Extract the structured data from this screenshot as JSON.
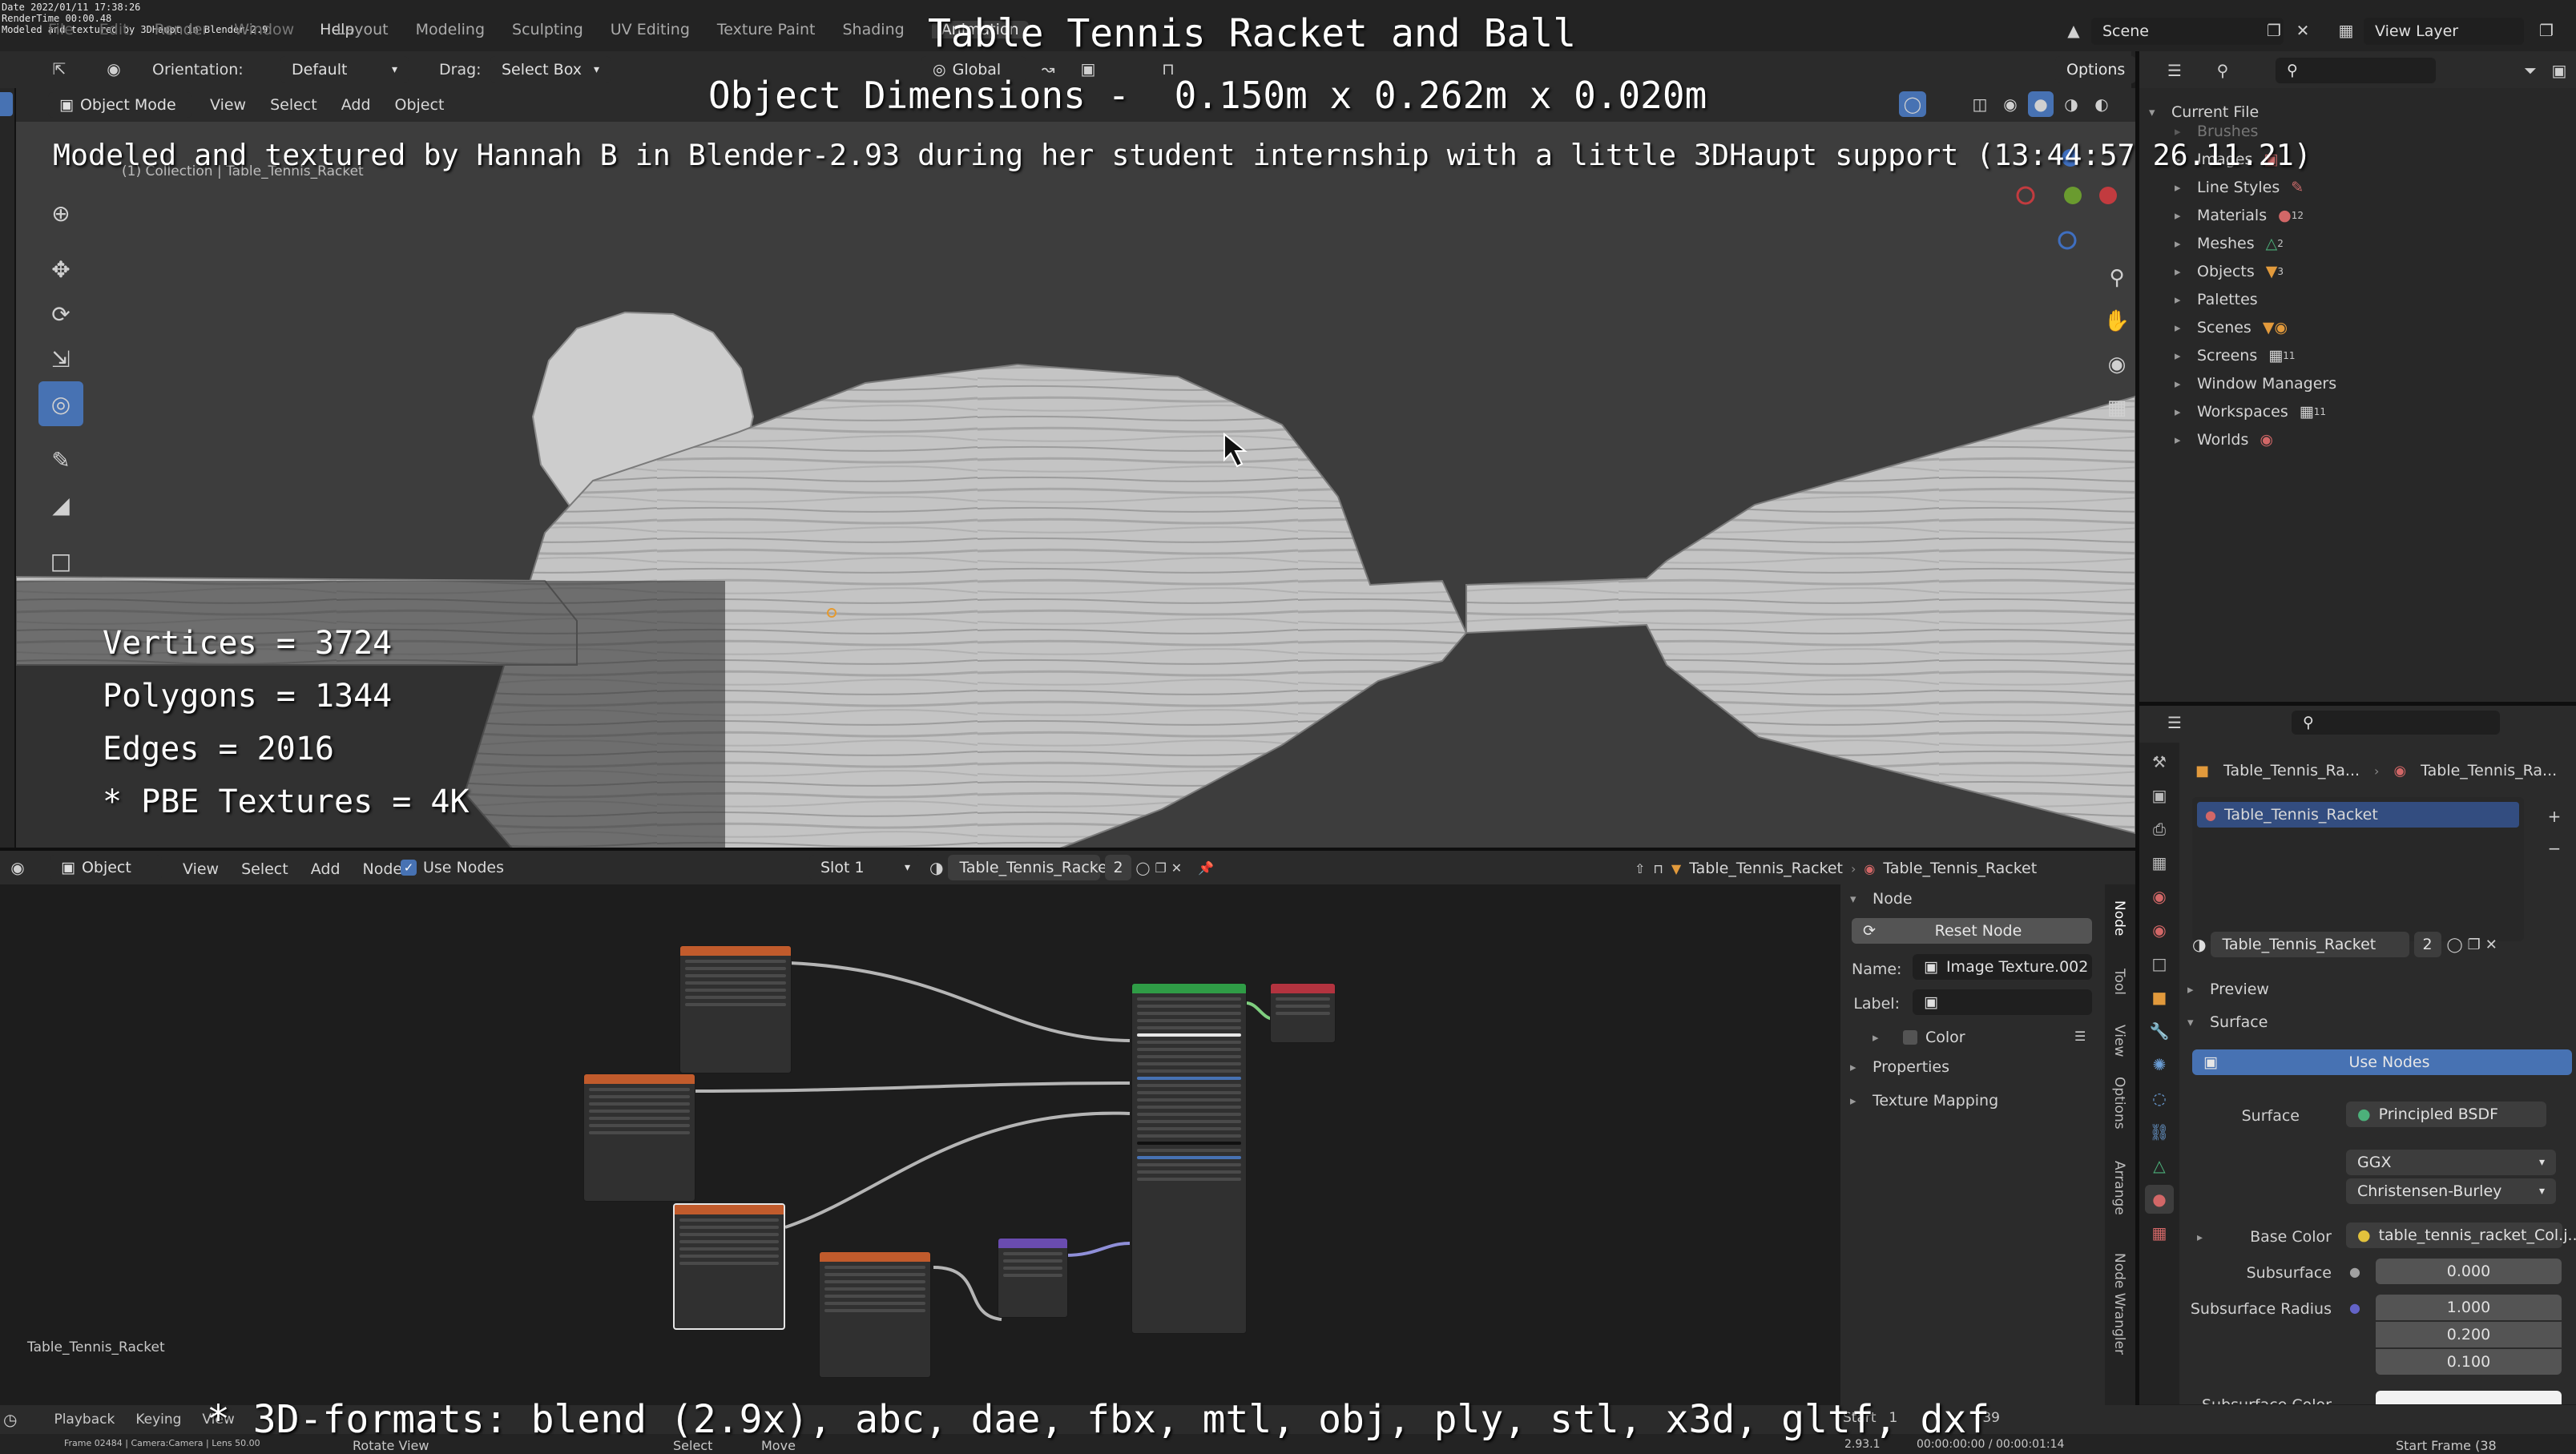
{
  "overlay": {
    "title": "Table Tennis Racket and Ball",
    "dims_label": "Object Dimensions -",
    "dims_values": "0.150m x 0.262m x 0.020m",
    "credit": "Modeled and textured by Hannah B in Blender-2.93 during her student internship with a little 3DHaupt support (13:44:57 26.11.21)",
    "stats": [
      "Vertices = 3724",
      "Polygons = 1344",
      "Edges = 2016",
      "* PBE Textures = 4K"
    ],
    "formats": "* 3D-formats: blend (2.9x), abc, dae, fbx, mtl, obj, ply, stl, x3d, gltf, dxf"
  },
  "tiny_meta": [
    "Date 2022/01/11 17:38:26",
    "RenderTime 00:00.48",
    "Modeled and textured by 3DHaupt in Blender-2.9"
  ],
  "topbar": {
    "menus": [
      "File",
      "Edit",
      "Render",
      "Window",
      "Help"
    ],
    "workspaces": [
      "Layout",
      "Modeling",
      "Sculpting",
      "UV Editing",
      "Texture Paint",
      "Shading",
      "Animation"
    ],
    "scene": "Scene",
    "view_layer": "View Layer"
  },
  "toolheader": {
    "orientation_label": "Orientation:",
    "orientation_value": "Default",
    "drag_label": "Drag:",
    "drag_value": "Select Box",
    "transform": "Global",
    "options": "Options"
  },
  "viewport": {
    "mode": "Object Mode",
    "menus": [
      "View",
      "Select",
      "Add",
      "Object"
    ],
    "collection": "(1) Collection | Table_Tennis_Racket"
  },
  "outliner": {
    "root": "Current File",
    "items": [
      "Brushes",
      "Images",
      "Line Styles",
      "Materials",
      "Meshes",
      "Objects",
      "Palettes",
      "Scenes",
      "Screens",
      "Window Managers",
      "Workspaces",
      "Worlds"
    ],
    "badges": {
      "Materials": "12",
      "Meshes": "2",
      "Objects": "3",
      "Screens": "11",
      "Workspaces": "11"
    }
  },
  "node_editor": {
    "type": "Object",
    "menus": [
      "View",
      "Select",
      "Add",
      "Node"
    ],
    "use_nodes": "Use Nodes",
    "slot": "Slot 1",
    "material": "Table_Tennis_Racket",
    "users": "2",
    "object_breadcrumb": "Table_Tennis_Racket",
    "mat_breadcrumb": "Table_Tennis_Racket",
    "footer_label": "Table_Tennis_Racket"
  },
  "npanel": {
    "section": "Node",
    "reset": "Reset Node",
    "name_label": "Name:",
    "name_value": "Image Texture.002",
    "label_label": "Label:",
    "color": "Color",
    "properties": "Properties",
    "texture_mapping": "Texture Mapping",
    "tabs": [
      "Node",
      "Tool",
      "View",
      "Options",
      "Arrange",
      "Node Wrangler"
    ]
  },
  "properties": {
    "breadcrumb_obj": "Table_Tennis_Ra...",
    "breadcrumb_mat": "Table_Tennis_Ra...",
    "slot_item": "Table_Tennis_Racket",
    "material": "Table_Tennis_Racket",
    "users": "2",
    "preview": "Preview",
    "surface": "Surface",
    "use_nodes": "Use Nodes",
    "surface_label": "Surface",
    "surface_value": "Principled BSDF",
    "distribution": "GGX",
    "subsurface_method": "Christensen-Burley",
    "base_color_label": "Base Color",
    "base_color_value": "table_tennis_racket_Col.j...",
    "subsurface_label": "Subsurface",
    "subsurface_value": "0.000",
    "radius_label": "Subsurface Radius",
    "radius_values": [
      "1.000",
      "0.200",
      "0.100"
    ],
    "subsurface_color_label": "Subsurface Color"
  },
  "timeline": {
    "playback": "Playback",
    "keying": "Keying",
    "view": "View",
    "start_label": "Start",
    "start_value": "1",
    "frame": "39",
    "start_frame": "Start Frame (38"
  },
  "statusbar": {
    "left": "Select",
    "middle": "Move",
    "version": "2.93.1",
    "time": "00:00:00:00 / 00:00:01:14",
    "rotate": "Rotate View",
    "render_meta": "Frame 02484 | Camera:Camera | Lens 50.00"
  },
  "colors": {
    "accent": "#4772b3",
    "panel": "#303030",
    "editor_bg": "#1d1d1d",
    "viewport_bg": "#3d3d3d",
    "header_orange": "#c15b2c",
    "header_green": "#2f9c46",
    "header_red": "#b3333f",
    "header_purple": "#6a4cb0"
  }
}
